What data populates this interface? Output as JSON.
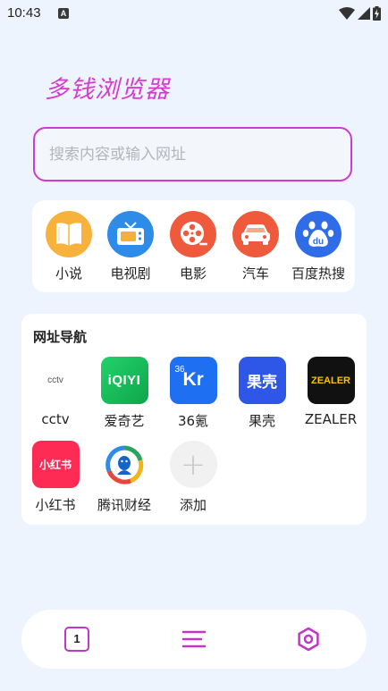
{
  "status_bar": {
    "time": "10:43",
    "notification_icon_letter": "A"
  },
  "app": {
    "title": "多钱浏览器"
  },
  "search": {
    "placeholder": "搜索内容或输入网址",
    "value": ""
  },
  "shortcuts": [
    {
      "label": "小说",
      "icon": "book-icon",
      "color": "#f6b23b"
    },
    {
      "label": "电视剧",
      "icon": "tv-icon",
      "color": "#2f8be8"
    },
    {
      "label": "电影",
      "icon": "film-reel-icon",
      "color": "#f05a3c"
    },
    {
      "label": "汽车",
      "icon": "car-icon",
      "color": "#f05a3c"
    },
    {
      "label": "百度热搜",
      "icon": "baidu-paw-icon",
      "color": "#2f6de8"
    }
  ],
  "nav_section": {
    "title": "网址导航",
    "items": [
      {
        "label": "cctv",
        "icon_text": "cctv"
      },
      {
        "label": "爱奇艺",
        "icon_text": "iQIYI"
      },
      {
        "label": "36氪",
        "icon_text_small": "36",
        "icon_text": "Kr"
      },
      {
        "label": "果壳",
        "icon_text": "果壳"
      },
      {
        "label": "ZEALER",
        "icon_text": "ZEALER"
      },
      {
        "label": "小红书",
        "icon_text": "小红书"
      },
      {
        "label": "腾讯财经",
        "icon_text": ""
      },
      {
        "label": "添加",
        "icon_text": "+"
      }
    ]
  },
  "bottom_bar": {
    "tab_count": "1"
  }
}
